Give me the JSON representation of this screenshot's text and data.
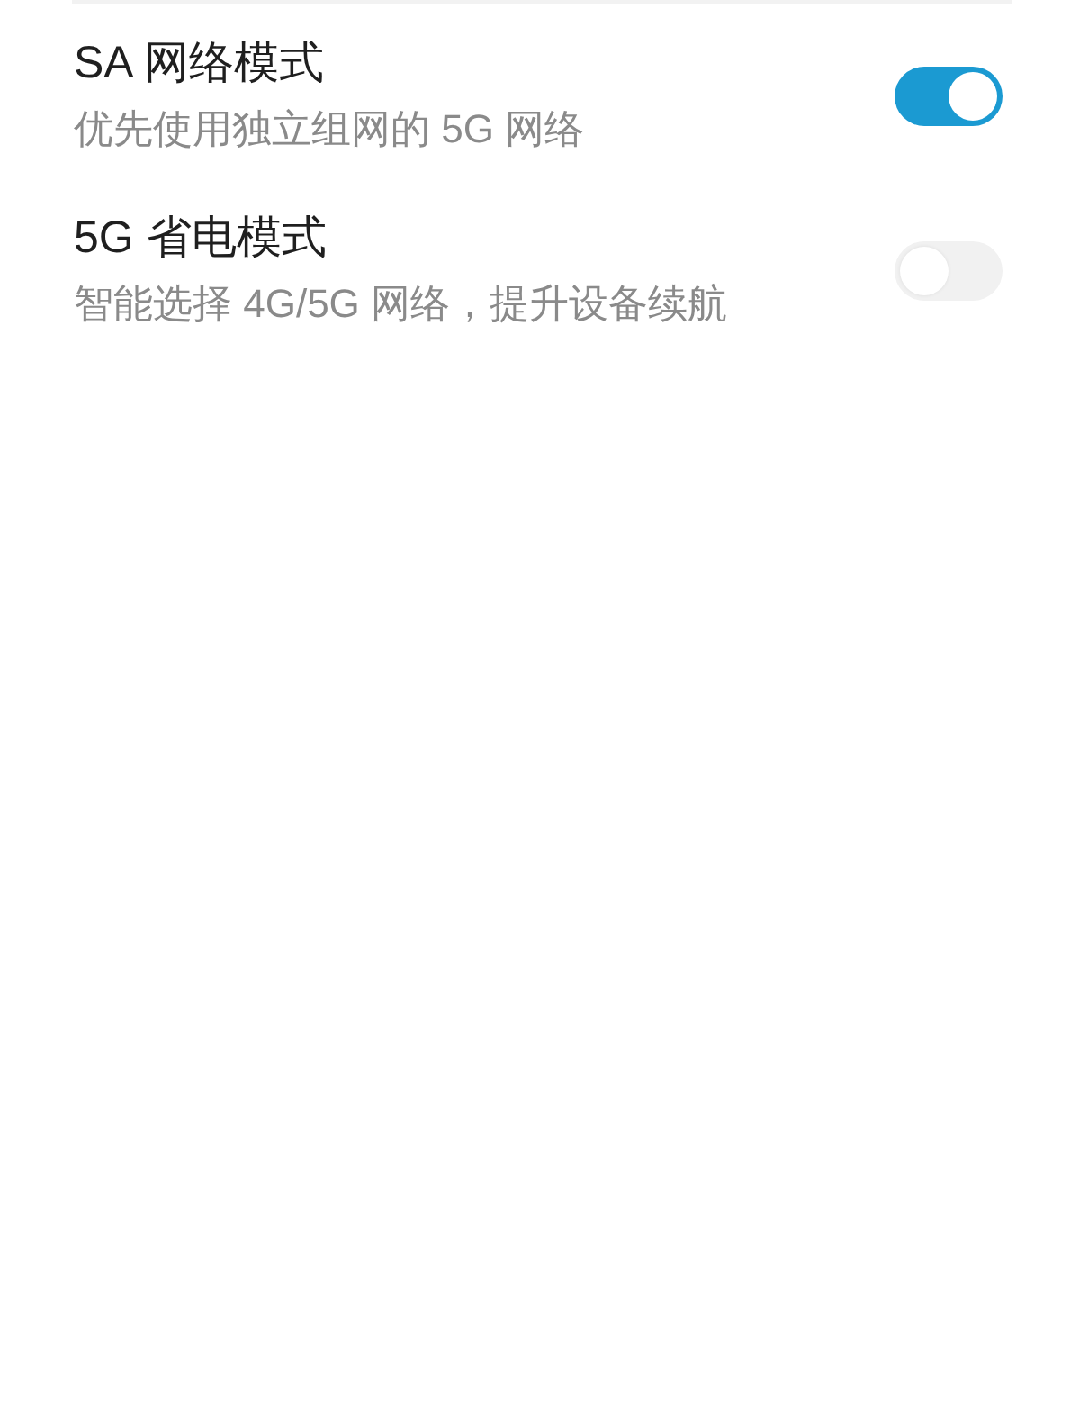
{
  "settings": [
    {
      "title": "SA 网络模式",
      "subtitle": "优先使用独立组网的 5G 网络",
      "on": true
    },
    {
      "title": "5G 省电模式",
      "subtitle": "智能选择 4G/5G 网络，提升设备续航",
      "on": false
    }
  ]
}
